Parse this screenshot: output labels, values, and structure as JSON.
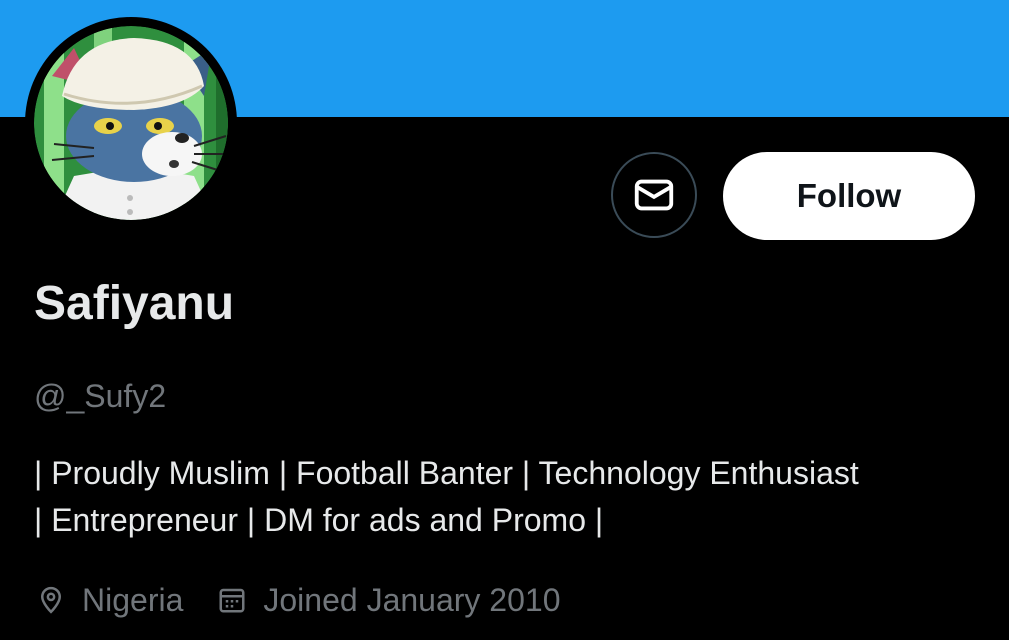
{
  "profile": {
    "display_name": "Safiyanu",
    "handle": "@_Sufy2",
    "bio_lines": [
      "| Proudly Muslim | Football Banter | Technology Enthusiast",
      "| Entrepreneur | DM for ads and Promo |"
    ],
    "location": "Nigeria",
    "joined": "Joined January 2010"
  },
  "actions": {
    "message_icon": "envelope-icon",
    "follow_label": "Follow"
  },
  "icons": {
    "location": "location-pin-icon",
    "calendar": "calendar-icon"
  },
  "colors": {
    "banner": "#1d9bf0",
    "background": "#000000",
    "primary_text": "#e7e9ea",
    "secondary_text": "#71767b",
    "follow_bg": "#ffffff"
  }
}
